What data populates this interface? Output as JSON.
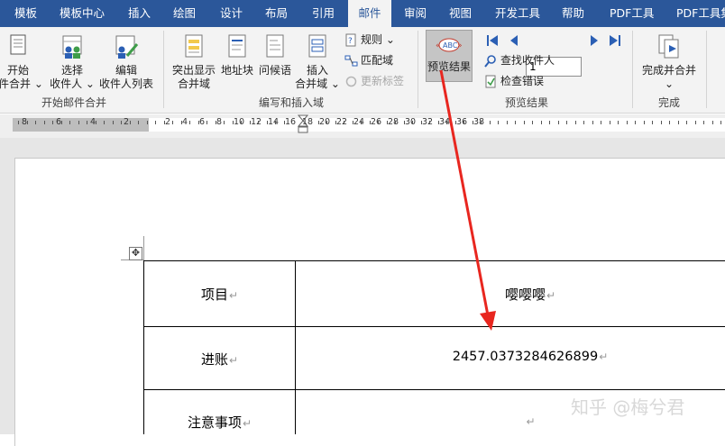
{
  "tabs": [
    "模板",
    "模板中心",
    "插入",
    "绘图",
    "设计",
    "布局",
    "引用",
    "邮件",
    "审阅",
    "视图",
    "开发工具",
    "帮助",
    "PDF工具",
    "PDF工具集"
  ],
  "active_tab": "邮件",
  "ribbon": {
    "start_merge": {
      "start_line1": "开始",
      "start_line2": "件合并 ⌄",
      "select_line1": "选择",
      "select_line2": "收件人 ⌄",
      "edit_line1": "编辑",
      "edit_line2": "收件人列表",
      "group_label": "开始邮件合并"
    },
    "write_insert": {
      "highlight_line1": "突出显示",
      "highlight_line2": "合并域",
      "address_block": "地址块",
      "greeting": "问候语",
      "insert_line1": "插入",
      "insert_line2": "合并域 ⌄",
      "rules": "规则 ⌄",
      "match_fields": "匹配域",
      "update_labels": "更新标签",
      "group_label": "编写和插入域"
    },
    "preview": {
      "preview_results": "预览结果",
      "record_value": "1",
      "find_recipient": "查找收件人",
      "check_errors": "检查错误",
      "group_label": "预览结果"
    },
    "finish": {
      "finish_line1": "完成并合并",
      "finish_line2": "⌄",
      "group_label": "完成"
    }
  },
  "ruler": {
    "left_numbers": [
      "8",
      "6",
      "4",
      "2"
    ],
    "right_numbers": [
      "2",
      "4",
      "6",
      "8",
      "10",
      "12",
      "14",
      "16",
      "18",
      "20",
      "22",
      "24",
      "26",
      "28",
      "30",
      "32",
      "34",
      "36",
      "38"
    ]
  },
  "table": {
    "rows": [
      {
        "label": "项目",
        "value": "嘤嘤嘤"
      },
      {
        "label": "进账",
        "value": "2457.0373284626899"
      },
      {
        "label": "注意事项",
        "value": ""
      }
    ],
    "paragraph_mark": "↵",
    "move_handle": "✥"
  },
  "watermark": "知乎 @梅兮君",
  "colors": {
    "tab_bar": "#2b579a",
    "ribbon_bg": "#f3f3f3",
    "arrow": "#e8261f",
    "icon_blue": "#2b5fb4"
  }
}
